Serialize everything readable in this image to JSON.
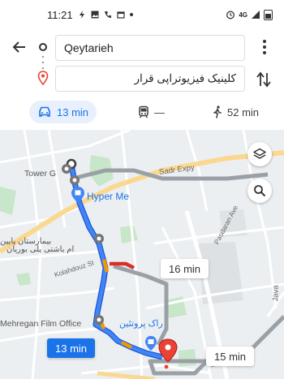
{
  "status_bar": {
    "time": "11:21",
    "network": "4G"
  },
  "directions": {
    "origin_value": "Qeytarieh",
    "destination_value": "کلینیک فیزیوتراپی قرار"
  },
  "modes": {
    "drive_time": "13 min",
    "transit_time": "—",
    "walk_time": "52 min",
    "selected": "drive"
  },
  "map": {
    "labels": {
      "tower": "Tower G",
      "hyper": "Hyper Me",
      "persian_1": "بیمارستان پایین",
      "persian_2": "ام باشتی پلی بوریان",
      "mehregan": "Mehregan Film Office",
      "persian_3": "راک پروتئین"
    },
    "roads": {
      "sadr": "Sadr Expy",
      "pasdaran": "Pasdaran Ave",
      "kolahdouz": "Kolahdouz St",
      "java": "Java"
    },
    "route_times": {
      "main": "13 min",
      "alt1": "16 min",
      "alt2": "15 min"
    }
  },
  "colors": {
    "accent": "#1a73e8",
    "route_main": "#4285f4",
    "route_alt": "#9aa0a6",
    "traffic_orange": "#f29900",
    "traffic_red": "#d93025",
    "destination_pin": "#ea4335",
    "highway": "#fbd88f",
    "park": "#c8e6c9"
  }
}
